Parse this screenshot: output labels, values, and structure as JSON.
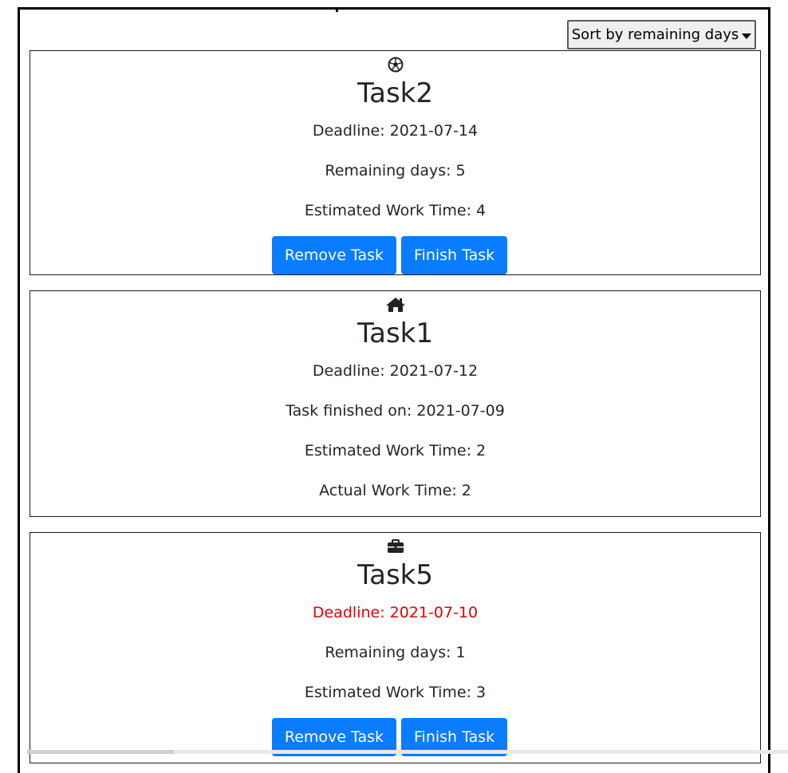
{
  "toolbar": {
    "sort_label": "Sort by remaining days"
  },
  "tasks": [
    {
      "icon": "soccer-ball-icon",
      "name": "Task2",
      "deadline": "Deadline: 2021-07-14",
      "line2": "Remaining days: 5",
      "line3": "Estimated Work Time: 4",
      "remove_label": "Remove Task",
      "finish_label": "Finish Task"
    },
    {
      "icon": "home-icon",
      "name": "Task1",
      "deadline": "Deadline: 2021-07-12",
      "line2": "Task finished on: 2021-07-09",
      "line3": "Estimated Work Time: 2",
      "line4": "Actual Work Time: 2"
    },
    {
      "icon": "briefcase-icon",
      "name": "Task5",
      "deadline": "Deadline: 2021-07-10",
      "deadline_color": "#e00000",
      "line2": "Remaining days: 1",
      "line3": "Estimated Work Time: 3",
      "remove_label": "Remove Task",
      "finish_label": "Finish Task"
    }
  ],
  "colors": {
    "button_blue": "#0a7cff",
    "overdue_red": "#e00000"
  }
}
